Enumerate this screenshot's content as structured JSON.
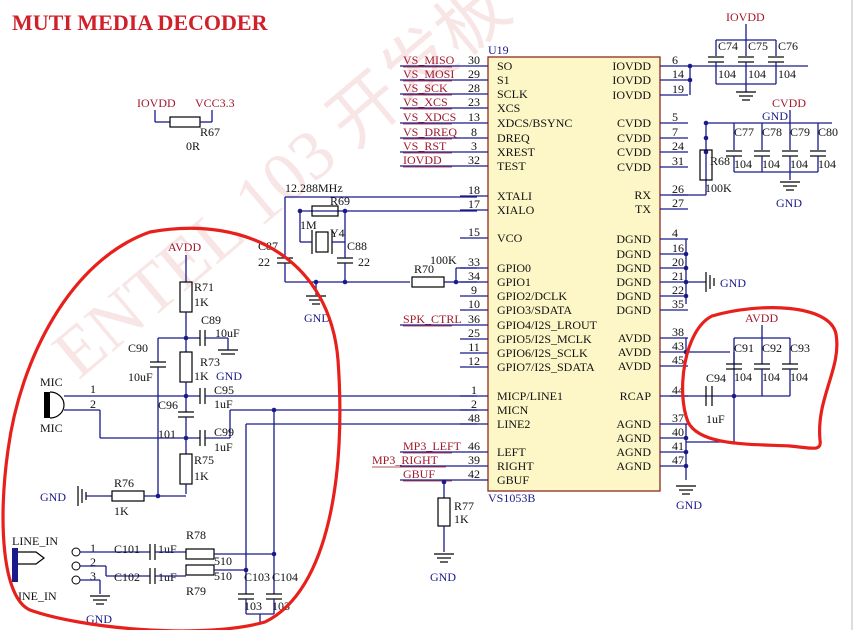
{
  "title": "MUTI MEDIA DECODER",
  "watermark": "ENTEL 103 开发板",
  "ic": {
    "ref": "U19",
    "part": "VS1053B",
    "left_pins": [
      {
        "num": "30",
        "name": "SO",
        "net": "VS_MISO"
      },
      {
        "num": "29",
        "name": "S1",
        "net": "VS_MOSI"
      },
      {
        "num": "28",
        "name": "SCLK",
        "net": "VS_SCK"
      },
      {
        "num": "23",
        "name": "XCS",
        "net": "VS_XCS"
      },
      {
        "num": "13",
        "name": "XDCS/BSYNC",
        "net": "VS_XDCS"
      },
      {
        "num": "8",
        "name": "DREQ",
        "net": "VS_DREQ"
      },
      {
        "num": "3",
        "name": "XREST",
        "net": "VS_RST"
      },
      {
        "num": "32",
        "name": "TEST",
        "net": "IOVDD"
      },
      {
        "num": "18",
        "name": "XTALI",
        "net": ""
      },
      {
        "num": "17",
        "name": "XIALO",
        "net": ""
      },
      {
        "num": "15",
        "name": "VCO",
        "net": ""
      },
      {
        "num": "33",
        "name": "GPIO0",
        "net": ""
      },
      {
        "num": "34",
        "name": "GPIO1",
        "net": ""
      },
      {
        "num": "9",
        "name": "GPIO2/DCLK",
        "net": ""
      },
      {
        "num": "10",
        "name": "GPIO3/SDATA",
        "net": ""
      },
      {
        "num": "36",
        "name": "GPIO4/I2S_LROUT",
        "net": "SPK_CTRL"
      },
      {
        "num": "25",
        "name": "GPIO5/I2S_MCLK",
        "net": ""
      },
      {
        "num": "11",
        "name": "GPIO6/I2S_SCLK",
        "net": ""
      },
      {
        "num": "12",
        "name": "GPIO7/I2S_SDATA",
        "net": ""
      },
      {
        "num": "1",
        "name": "MICP/LINE1",
        "net": ""
      },
      {
        "num": "2",
        "name": "MICN",
        "net": ""
      },
      {
        "num": "48",
        "name": "LINE2",
        "net": ""
      },
      {
        "num": "46",
        "name": "LEFT",
        "net": "MP3_LEFT"
      },
      {
        "num": "39",
        "name": "RIGHT",
        "net": "MP3_RIGHT"
      },
      {
        "num": "42",
        "name": "GBUF",
        "net": "GBUF"
      }
    ],
    "right_pins": [
      {
        "num": "6",
        "name": "IOVDD"
      },
      {
        "num": "14",
        "name": "IOVDD"
      },
      {
        "num": "19",
        "name": "IOVDD"
      },
      {
        "num": "5",
        "name": "CVDD"
      },
      {
        "num": "7",
        "name": "CVDD"
      },
      {
        "num": "24",
        "name": "CVDD"
      },
      {
        "num": "31",
        "name": "CVDD"
      },
      {
        "num": "26",
        "name": "RX"
      },
      {
        "num": "27",
        "name": "TX"
      },
      {
        "num": "4",
        "name": "DGND"
      },
      {
        "num": "16",
        "name": "DGND"
      },
      {
        "num": "20",
        "name": "DGND"
      },
      {
        "num": "21",
        "name": "DGND"
      },
      {
        "num": "22",
        "name": "DGND"
      },
      {
        "num": "35",
        "name": "DGND"
      },
      {
        "num": "38",
        "name": "AVDD"
      },
      {
        "num": "43",
        "name": "AVDD"
      },
      {
        "num": "45",
        "name": "AVDD"
      },
      {
        "num": "44",
        "name": "RCAP"
      },
      {
        "num": "37",
        "name": "AGND"
      },
      {
        "num": "40",
        "name": "AGND"
      },
      {
        "num": "41",
        "name": "AGND"
      },
      {
        "num": "47",
        "name": "AGND"
      }
    ]
  },
  "labels": {
    "iovdd": "IOVDD",
    "vcc33": "VCC3.3",
    "r67": "R67",
    "r67v": "0R",
    "xtal_freq": "12.288MHz",
    "r69": "R69",
    "r69v": "1M",
    "y4": "Y4",
    "c87": "C87",
    "c87v": "22",
    "c88": "C88",
    "c88v": "22",
    "r70": "R70",
    "r70v": "100K",
    "gnd": "GND",
    "avdd": "AVDD",
    "cvdd": "CVDD",
    "r68": "R68",
    "r68v": "100K",
    "c74": "C74",
    "c75": "C75",
    "c76": "C76",
    "c77": "C77",
    "c78": "C78",
    "c79": "C79",
    "c80": "C80",
    "c91": "C91",
    "c92": "C92",
    "c93": "C93",
    "c94": "C94",
    "c94v": "1uF",
    "cap104": "104",
    "r71": "R71",
    "r71v": "1K",
    "c89": "C89",
    "c89v": "10uF",
    "c90": "C90",
    "c90v": "10uF",
    "r73": "R73",
    "r73v": "1K",
    "c95": "C95",
    "c95v": "1uF",
    "c96": "C96",
    "c96v": "101",
    "c99": "C99",
    "c99v": "1uF",
    "r75": "R75",
    "r75v": "1K",
    "r76": "R76",
    "r76v": "1K",
    "mic": "MIC",
    "mic2": "MIC",
    "mic_p1": "1",
    "mic_p2": "2",
    "line_in": "LINE_IN",
    "line_in2": "INE_IN",
    "jp1": "1",
    "jp2": "2",
    "jp3": "3",
    "c101": "C101",
    "c101v": "1uF",
    "c102": "C102",
    "c102v": "1uF",
    "r78": "R78",
    "r78v": "510",
    "r79": "R79",
    "r79v": "510",
    "c103": "C103",
    "c103v": "103",
    "c104": "C104",
    "c104v": "103",
    "r77": "R77",
    "r77v": "1K"
  },
  "colors": {
    "wire": "#1a1a8c",
    "net": "#a0192c",
    "title": "#d0202a",
    "highlight": "#e8201c"
  }
}
